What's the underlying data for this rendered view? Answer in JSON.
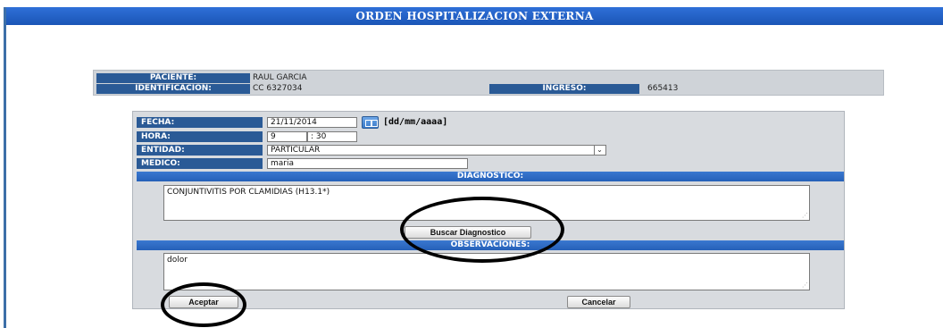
{
  "title": "ORDEN HOSPITALIZACION EXTERNA",
  "patient": {
    "paciente_label": "PACIENTE:",
    "paciente_value": "RAUL GARCIA",
    "identificacion_label": "IDENTIFICACION:",
    "identificacion_value": "CC 6327034",
    "ingreso_label": "INGRESO:",
    "ingreso_value": "665413"
  },
  "form": {
    "fecha_label": "FECHA:",
    "fecha_value": "21/11/2014",
    "fecha_format": "[dd/mm/aaaa]",
    "hora_label": "HORA:",
    "hora_hour": "9",
    "hora_sep": ":",
    "hora_minute": "30",
    "entidad_label": "ENTIDAD:",
    "entidad_value": "PARTICULAR",
    "medico_label": "MEDICO:",
    "medico_value": "maria",
    "diagnostico_header": "DIAGNOSTICO:",
    "diagnostico_value": "CONJUNTIVITIS POR CLAMIDIAS (H13.1*)",
    "buscar_label": "Buscar Diagnostico",
    "observaciones_header": "OBSERVACIONES:",
    "observaciones_value": "dolor",
    "aceptar_label": "Aceptar",
    "cancelar_label": "Cancelar"
  },
  "icons": {
    "calendar": "calendar-icon",
    "select_arrow": "chevron-down-icon",
    "select_arrow_glyph": "⌄",
    "resize_grip": "resize-grip-icon",
    "resize_grip_glyph": "⋰"
  },
  "colors": {
    "title_bar": "#1b55b6",
    "label_bg": "#2a5a96",
    "panel_bg": "#d8dbdf",
    "annotation": "#000000"
  }
}
